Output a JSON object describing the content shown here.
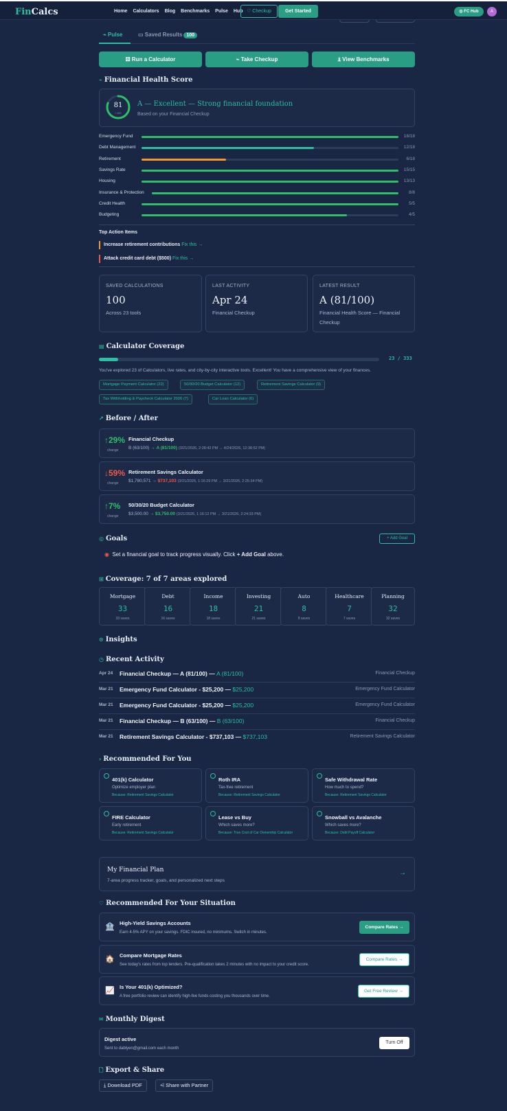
{
  "header": {
    "logo_a": "Fin",
    "logo_b": "Calcs",
    "nav": [
      "Home",
      "Calculators",
      "Blog",
      "Benchmarks",
      "Pulse",
      "Hub"
    ],
    "checkup": "♡ Checkup",
    "get_started": "Get Started",
    "fc_hub": "◎ FC Hub",
    "avatar": "A"
  },
  "tabs": {
    "pulse": "⌁ Pulse",
    "saved": "▭ Saved Results",
    "saved_count": "100"
  },
  "actions": {
    "run": "⚄ Run a Calculator",
    "checkup": "⌁ Take Checkup",
    "benchmarks": "⫫ View Benchmarks"
  },
  "health": {
    "title": "Financial Health Score",
    "score": "81",
    "score_of": "/ 100",
    "score_fraction": 0.81,
    "grade": "A — Excellent — Strong financial foundation",
    "sub": "Based on your Financial Checkup",
    "bars": [
      {
        "label": "Emergency Fund",
        "value": "18/18",
        "pct": 100,
        "color": "#2fbf6b"
      },
      {
        "label": "Debt Management",
        "value": "12/18",
        "pct": 67,
        "color": "#2bbfa3"
      },
      {
        "label": "Retirement",
        "value": "6/18",
        "pct": 33,
        "color": "#f29a2e"
      },
      {
        "label": "Savings Rate",
        "value": "15/15",
        "pct": 100,
        "color": "#2fbf6b"
      },
      {
        "label": "Housing",
        "value": "13/13",
        "pct": 100,
        "color": "#2fbf6b"
      },
      {
        "label": "Insurance & Protection",
        "value": "8/8",
        "pct": 100,
        "color": "#2fbf6b"
      },
      {
        "label": "Credit Health",
        "value": "5/5",
        "pct": 100,
        "color": "#2fbf6b"
      },
      {
        "label": "Budgeting",
        "value": "4/5",
        "pct": 80,
        "color": "#2fbf6b"
      }
    ],
    "top_actions_title": "Top Action Items",
    "top_actions": [
      {
        "text": "Increase retirement contributions",
        "fix": "Fix this →",
        "color": "#f29a2e"
      },
      {
        "text": "Attack credit card debt ($500)",
        "fix": "Fix this →",
        "color": "#ef5a4a"
      }
    ]
  },
  "stats": [
    {
      "title": "SAVED CALCULATIONS",
      "value": "100",
      "sub": "Across 23 tools"
    },
    {
      "title": "LAST ACTIVITY",
      "value": "Apr 24",
      "sub": "Financial Checkup"
    },
    {
      "title": "LATEST RESULT",
      "value": "A (81/100)",
      "sub": "Financial Health Score — Financial Checkup"
    }
  ],
  "coverage": {
    "title": "Calculator Coverage",
    "value": "23 / 333",
    "fraction": 0.069,
    "text": "You've explored 23 of Calculators, live rates, and city-by-city interactive tools. Excellent! You have a comprehensive view of your finances.",
    "chips": [
      "Mortgage Payment Calculator (22)",
      "50/30/20 Budget Calculator (12)",
      "Retirement Savings Calculator (9)",
      "Tax Withholding & Paycheck Calculator 2026 (7)",
      "Car Loan Calculator (6)"
    ]
  },
  "before_after": {
    "title": "Before / After",
    "change_label": "change",
    "items": [
      {
        "pct": "↑29%",
        "title": "Financial Checkup",
        "before": "B (63/100) →",
        "after": "A (81/100)",
        "ts": "(3/21/2026, 2:28:42 PM → 4/24/2026, 12:38:52 PM)",
        "dir": "up"
      },
      {
        "pct": "↓59%",
        "title": "Retirement Savings Calculator",
        "before": "$1,780,571 →",
        "after": "$737,103",
        "ts": "(3/21/2026, 1:16:29 PM → 3/21/2026, 2:25:34 PM)",
        "dir": "down"
      },
      {
        "pct": "↑7%",
        "title": "50/30/20 Budget Calculator",
        "before": "$3,500.00 →",
        "after": "$3,750.00",
        "ts": "(3/21/2026, 1:16:12 PM → 3/21/2026, 2:24:33 PM)",
        "dir": "up"
      }
    ]
  },
  "goals": {
    "title": "Goals",
    "add": "+ Add Goal",
    "text_a": "Set a financial goal to track progress visually. Click ",
    "text_b": "+ Add Goal",
    "text_c": " above."
  },
  "areas": {
    "title": "Coverage: 7 of 7 areas explored",
    "items": [
      {
        "name": "Mortgage",
        "count": "33",
        "saves": "33 saves"
      },
      {
        "name": "Debt",
        "count": "16",
        "saves": "16 saves"
      },
      {
        "name": "Income",
        "count": "18",
        "saves": "18 saves"
      },
      {
        "name": "Investing",
        "count": "21",
        "saves": "21 saves"
      },
      {
        "name": "Auto",
        "count": "8",
        "saves": "8 saves"
      },
      {
        "name": "Healthcare",
        "count": "7",
        "saves": "7 saves"
      },
      {
        "name": "Planning",
        "count": "32",
        "saves": "32 saves"
      }
    ]
  },
  "insights": {
    "title": "Insights"
  },
  "activity": {
    "title": "Recent Activity",
    "items": [
      {
        "date": "Apr 24",
        "text": "Financial Checkup — A (81/100) — ",
        "value": "A (81/100)",
        "tool": "Financial Checkup"
      },
      {
        "date": "Mar 21",
        "text": "Emergency Fund Calculator - $25,200 — ",
        "value": "$25,200",
        "tool": "Emergency Fund Calculator"
      },
      {
        "date": "Mar 21",
        "text": "Emergency Fund Calculator - $25,200 — ",
        "value": "$25,200",
        "tool": "Emergency Fund Calculator"
      },
      {
        "date": "Mar 21",
        "text": "Financial Checkup — B (63/100) — ",
        "value": "B (63/100)",
        "tool": "Financial Checkup"
      },
      {
        "date": "Mar 21",
        "text": "Retirement Savings Calculator - $737,103 — ",
        "value": "$737,103",
        "tool": "Retirement Savings Calculator"
      }
    ]
  },
  "recommended": {
    "title": "Recommended For You",
    "items": [
      {
        "title": "401(k) Calculator",
        "sub": "Optimize employer plan",
        "because": "Because: Retirement Savings Calculator"
      },
      {
        "title": "Roth IRA",
        "sub": "Tax-free retirement",
        "because": "Because: Retirement Savings Calculator"
      },
      {
        "title": "Safe Withdrawal Rate",
        "sub": "How much to spend?",
        "because": "Because: Retirement Savings Calculator"
      },
      {
        "title": "FIRE Calculator",
        "sub": "Early retirement",
        "because": "Because: Retirement Savings Calculator"
      },
      {
        "title": "Lease vs Buy",
        "sub": "Which saves more?",
        "because": "Because: True Cost of Car Ownership Calculator"
      },
      {
        "title": "Snowball vs Avalanche",
        "sub": "Which saves more?",
        "because": "Because: Debt Payoff Calculator"
      }
    ]
  },
  "plan": {
    "title": "My Financial Plan",
    "sub": "7-area progress tracker, goals, and personalized next steps",
    "arrow": "→"
  },
  "situation": {
    "title": "Recommended For Your Situation",
    "items": [
      {
        "icon": "🏦",
        "title": "High-Yield Savings Accounts",
        "sub": "Earn 4-5% APY on your savings. FDIC insured, no minimums. Switch in minutes.",
        "btn": "Compare Rates →",
        "filled": true
      },
      {
        "icon": "🏠",
        "title": "Compare Mortgage Rates",
        "sub": "See today's rates from top lenders. Pre-qualification takes 2 minutes with no impact to your credit score.",
        "btn": "Compare Rates →",
        "filled": false
      },
      {
        "icon": "📈",
        "title": "Is Your 401(k) Optimized?",
        "sub": "A free portfolio review can identify high-fee funds costing you thousands over time.",
        "btn": "Get Free Review →",
        "filled": false
      }
    ]
  },
  "digest": {
    "title": "Monthly Digest",
    "status": "Digest active",
    "sub": "Sent to dablyen@gmail.com each month",
    "btn": "Turn Off"
  },
  "export": {
    "title": "Export & Share",
    "pdf": "⤓ Download PDF",
    "share": "⩤ Share with Partner"
  }
}
